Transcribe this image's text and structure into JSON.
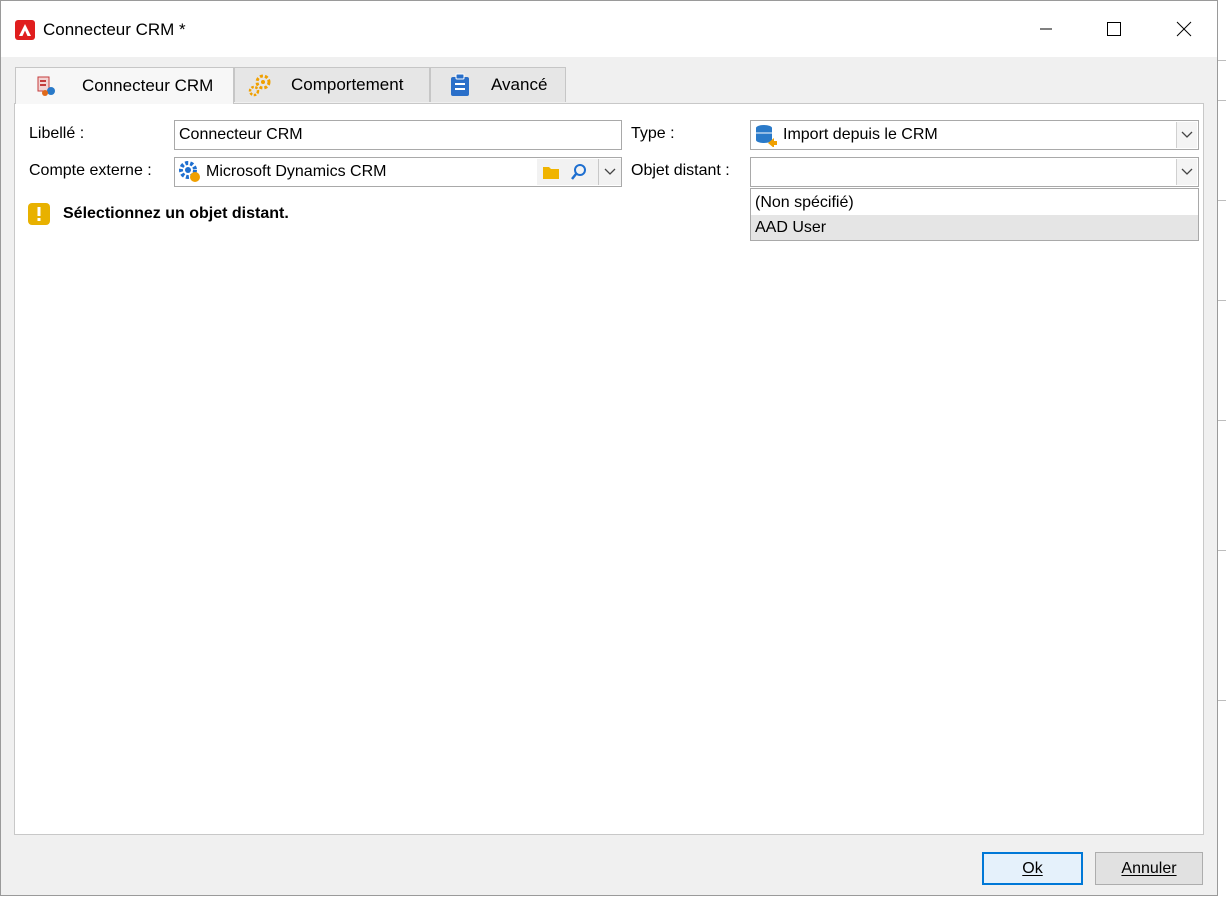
{
  "window": {
    "title": "Connecteur CRM *"
  },
  "tabs": [
    {
      "label": "Connecteur CRM",
      "icon": "crm-connector-icon",
      "active": true
    },
    {
      "label": "Comportement",
      "icon": "gears-icon",
      "active": false
    },
    {
      "label": "Avancé",
      "icon": "clipboard-icon",
      "active": false
    }
  ],
  "form": {
    "libelle_label": "Libellé :",
    "libelle_value": "Connecteur CRM",
    "compte_label": "Compte externe :",
    "compte_value": "Microsoft Dynamics CRM",
    "type_label": "Type :",
    "type_value": "Import depuis le CRM",
    "objet_label": "Objet distant :",
    "objet_value": ""
  },
  "dropdown": {
    "options": [
      "(Non spécifié)",
      "AAD User"
    ],
    "highlighted_index": 1
  },
  "warning": {
    "text": "Sélectionnez un objet distant."
  },
  "buttons": {
    "ok": "Ok",
    "cancel": "Annuler"
  },
  "colors": {
    "accent": "#0078d7",
    "warning": "#e8b100",
    "brand": "#e01e1e"
  }
}
